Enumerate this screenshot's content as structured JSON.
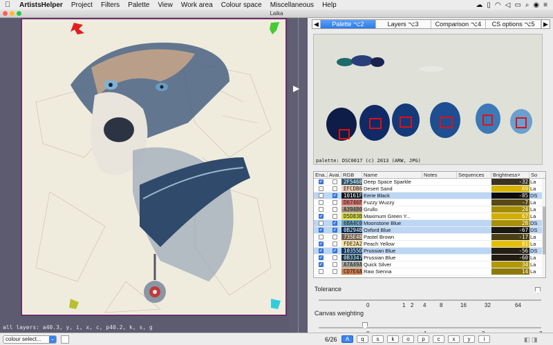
{
  "menubar": {
    "apple": "",
    "app_name": "ArtistsHelper",
    "items": [
      "Project",
      "Filters",
      "Palette",
      "View",
      "Work area",
      "Colour space",
      "Miscellaneous",
      "Help"
    ]
  },
  "window": {
    "title": "Laika"
  },
  "left": {
    "status_text": "all layers: a40.3, y, i, x, c, p40.2, k, s, g"
  },
  "tabs": {
    "items": [
      {
        "label": "Palette ⌥2",
        "active": true
      },
      {
        "label": "Layers ⌥3",
        "active": false
      },
      {
        "label": "Comparison ⌥4",
        "active": false
      },
      {
        "label": "CS options ⌥5",
        "active": false
      }
    ]
  },
  "palette_image": {
    "caption": "palette: DSC0017 (c) 2013 (ARW, JPG)"
  },
  "table": {
    "headers": [
      "Ena...",
      "Avai...",
      "RGB",
      "Name",
      "Notes",
      "Sequences",
      "Brightness˅",
      "So"
    ],
    "rows": [
      {
        "enabled": true,
        "avail": false,
        "rgb": "2F5468",
        "rgb_color": "#2F5468",
        "name": "Deep Space Sparkle",
        "brightness": "-32",
        "bcolor": "#3a3222",
        "sort": "La",
        "sel": false
      },
      {
        "enabled": false,
        "avail": false,
        "rgb": "EFCDB6",
        "rgb_color": "#EFCDB6",
        "name": "Desert Sand",
        "brightness": "69",
        "bcolor": "#d6b300",
        "sort": "La",
        "sel": false
      },
      {
        "enabled": false,
        "avail": true,
        "rgb": "10161F",
        "rgb_color": "#10161F",
        "name": "Eerie Black",
        "brightness": "-85",
        "bcolor": "#0d0d0d",
        "sort": "DS",
        "sel": true
      },
      {
        "enabled": false,
        "avail": false,
        "rgb": "D6746F",
        "rgb_color": "#D6746F",
        "name": "Fuzzy Wuzzy",
        "brightness": "-7",
        "bcolor": "#5a4a14",
        "sort": "La",
        "sel": false
      },
      {
        "enabled": false,
        "avail": false,
        "rgb": "A39480",
        "rgb_color": "#A39480",
        "name": "Grullo",
        "brightness": "24",
        "bcolor": "#a48c05",
        "sort": "La",
        "sel": false
      },
      {
        "enabled": true,
        "avail": false,
        "rgb": "D5D83B",
        "rgb_color": "#D5D83B",
        "name": "Maximum Green Y...",
        "brightness": "67",
        "bcolor": "#d1af00",
        "sort": "La",
        "sel": false
      },
      {
        "enabled": false,
        "avail": true,
        "rgb": "6BA4C0",
        "rgb_color": "#6BA4C0",
        "name": "Moonstone Blue",
        "brightness": "28",
        "bcolor": "#a99006",
        "sort": "DS",
        "sel": true
      },
      {
        "enabled": true,
        "avail": true,
        "rgb": "0B294B",
        "rgb_color": "#0B294B",
        "name": "Oxford Blue",
        "brightness": "-67",
        "bcolor": "#1b1810",
        "sort": "DS",
        "sel": true
      },
      {
        "enabled": false,
        "avail": false,
        "rgb": "735E48",
        "rgb_color": "#735E48",
        "name": "Pastel Brown",
        "brightness": "-17",
        "bcolor": "#4a3f15",
        "sort": "La",
        "sel": false
      },
      {
        "enabled": true,
        "avail": false,
        "rgb": "FDE2A2",
        "rgb_color": "#FDE2A2",
        "name": "Peach Yellow",
        "brightness": "81",
        "bcolor": "#e6c000",
        "sort": "La",
        "sel": false
      },
      {
        "enabled": true,
        "avail": true,
        "rgb": "10355D",
        "rgb_color": "#10355D",
        "name": "Prussian Blue",
        "brightness": "-56",
        "bcolor": "#231f12",
        "sort": "DS",
        "sel": true
      },
      {
        "enabled": true,
        "avail": false,
        "rgb": "0B3347",
        "rgb_color": "#0B3347",
        "name": "Prussian Blue",
        "brightness": "-60",
        "bcolor": "#201c11",
        "sort": "La",
        "sel": false
      },
      {
        "enabled": true,
        "avail": false,
        "rgb": "A7A49A",
        "rgb_color": "#A7A49A",
        "name": "Quick Silver",
        "brightness": "34",
        "bcolor": "#b19805",
        "sort": "La",
        "sel": false
      },
      {
        "enabled": false,
        "avail": false,
        "rgb": "CD7E4A",
        "rgb_color": "#CD7E4A",
        "name": "Raw Sienna",
        "brightness": "14",
        "bcolor": "#8e7a0b",
        "sort": "La",
        "sel": false
      }
    ]
  },
  "sliders": {
    "tolerance_label": "Tolerance",
    "tolerance_ticks": [
      "0",
      "1",
      "2",
      "4",
      "8",
      "16",
      "32",
      "64"
    ],
    "weighting_label": "Canvas weighting",
    "weighting_ticks": [
      "0",
      "1",
      "2",
      "3"
    ]
  },
  "bottom": {
    "select_label": "colour select...",
    "counter": "6/26",
    "keys": [
      {
        "label": "A",
        "active": true
      },
      {
        "label": "q",
        "active": false
      },
      {
        "label": "s",
        "active": false
      },
      {
        "label": "k",
        "active": false
      },
      {
        "label": "o",
        "active": false
      },
      {
        "label": "p",
        "active": false
      },
      {
        "label": "c",
        "active": false
      },
      {
        "label": "x",
        "active": false
      },
      {
        "label": "y",
        "active": false
      },
      {
        "label": "i",
        "active": false
      }
    ]
  }
}
